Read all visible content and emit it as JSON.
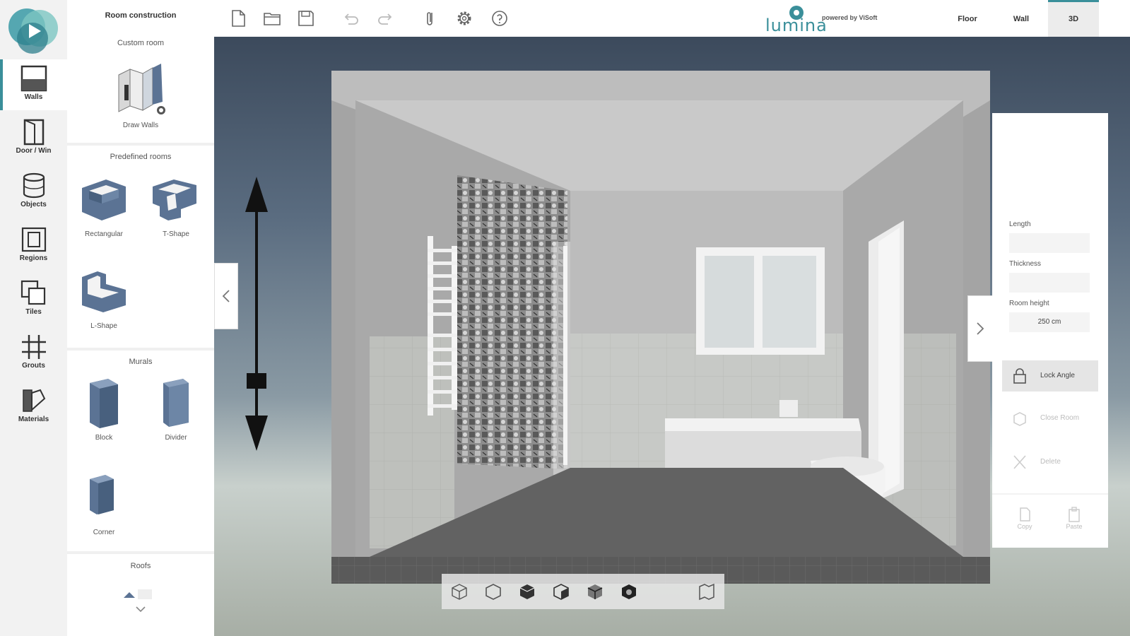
{
  "rail": {
    "items": [
      {
        "label": "Walls",
        "icon": "walls-icon",
        "active": true
      },
      {
        "label": "Door / Win",
        "icon": "door-window-icon"
      },
      {
        "label": "Objects",
        "icon": "objects-icon"
      },
      {
        "label": "Regions",
        "icon": "regions-icon"
      },
      {
        "label": "Tiles",
        "icon": "tiles-icon"
      },
      {
        "label": "Grouts",
        "icon": "grouts-icon"
      },
      {
        "label": "Materials",
        "icon": "materials-icon"
      }
    ]
  },
  "catalog": {
    "title": "Room construction",
    "custom_room": "Custom room",
    "draw_walls": "Draw Walls",
    "predefined_rooms": "Predefined rooms",
    "rectangular": "Rectangular",
    "t_shape": "T-Shape",
    "l_shape": "L-Shape",
    "murals": "Murals",
    "block": "Block",
    "divider": "Divider",
    "corner": "Corner",
    "roofs": "Roofs"
  },
  "brand": {
    "name": "lumina",
    "powered_by": "powered by ViSoft"
  },
  "view_tabs": {
    "floor": "Floor",
    "wall": "Wall",
    "threed": "3D"
  },
  "props": {
    "length_label": "Length",
    "thickness_label": "Thickness",
    "room_height_label": "Room height",
    "room_height_value": "250 cm",
    "lock_angle": "Lock Angle",
    "close_room": "Close Room",
    "delete": "Delete",
    "copy": "Copy",
    "paste": "Paste"
  },
  "colors": {
    "accent": "#3a8f9a",
    "wall_blue": "#5b7394"
  }
}
